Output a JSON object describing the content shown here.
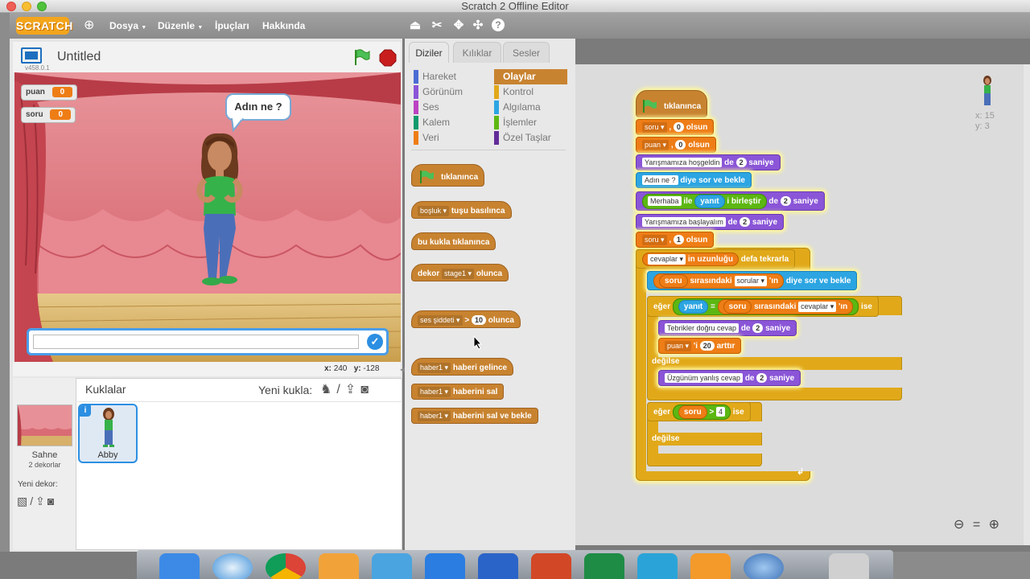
{
  "window": {
    "title": "Scratch 2 Offline Editor"
  },
  "menubar": {
    "logo": "SCRATCH",
    "items": [
      {
        "label": "Dosya",
        "has_arrow": true
      },
      {
        "label": "Düzenle",
        "has_arrow": true
      },
      {
        "label": "İpuçları",
        "has_arrow": false
      },
      {
        "label": "Hakkında",
        "has_arrow": false
      }
    ],
    "tools": [
      "duplicate-icon",
      "cut-icon",
      "grow-icon",
      "shrink-icon",
      "help-icon"
    ]
  },
  "stage": {
    "project_title": "Untitled",
    "version": "v458.0.1",
    "monitors": [
      {
        "name": "puan",
        "value": "0"
      },
      {
        "name": "soru",
        "value": "0"
      }
    ],
    "speech_bubble": "Adın ne ?",
    "answer_value": "",
    "coords": {
      "x_label": "x:",
      "x_value": "240",
      "y_label": "y:",
      "y_value": "-128"
    }
  },
  "sprites": {
    "heading": "Kuklalar",
    "new_sprite_label": "Yeni kukla:",
    "stage_label": "Sahne",
    "stage_backdrops": "2 dekorlar",
    "new_backdrop_label": "Yeni dekor:",
    "items": [
      {
        "name": "Abby",
        "selected": true
      }
    ]
  },
  "tabs": [
    {
      "label": "Diziler",
      "active": true
    },
    {
      "label": "Kılıklar",
      "active": false
    },
    {
      "label": "Sesler",
      "active": false
    }
  ],
  "categories": {
    "left": [
      {
        "label": "Hareket",
        "color": "#4a6cd4"
      },
      {
        "label": "Görünüm",
        "color": "#8a55d7"
      },
      {
        "label": "Ses",
        "color": "#bb42c3"
      },
      {
        "label": "Kalem",
        "color": "#0e9a6c"
      },
      {
        "label": "Veri",
        "color": "#ee7d16"
      }
    ],
    "right": [
      {
        "label": "Olaylar",
        "color": "#c88330",
        "active": true
      },
      {
        "label": "Kontrol",
        "color": "#e1a91a",
        "active": false
      },
      {
        "label": "Algılama",
        "color": "#2ca5e2",
        "active": false
      },
      {
        "label": "İşlemler",
        "color": "#5cb712",
        "active": false
      },
      {
        "label": "Özel Taşlar",
        "color": "#632d99",
        "active": false
      }
    ]
  },
  "palette": {
    "flag_clicked": "tıklanınca",
    "key_pressed": {
      "key": "boşluk",
      "text": "tuşu basılınca"
    },
    "sprite_clicked": "bu kukla tıklanınca",
    "backdrop_switch": {
      "prefix": "dekor",
      "value": "stage1",
      "suffix": "olunca"
    },
    "sensor": {
      "value": "ses şiddeti",
      "op": ">",
      "num": "10",
      "suffix": "olunca"
    },
    "receive": {
      "msg": "haber1",
      "text": "haberi gelince"
    },
    "broadcast": {
      "msg": "haber1",
      "text": "haberini sal"
    },
    "broadcast_wait": {
      "msg": "haber1",
      "text": "haberini sal ve bekle"
    }
  },
  "script": {
    "hat": "tıklanınca",
    "set1": {
      "var": "soru",
      "comma": ",",
      "value": "0",
      "suffix": "olsun"
    },
    "set2": {
      "var": "puan",
      "comma": ",",
      "value": "0",
      "suffix": "olsun"
    },
    "say1": {
      "text": "Yarışmamıza hoşgeldin",
      "de": "de",
      "secs": "2",
      "unit": "saniye"
    },
    "ask": {
      "text": "Adın ne ?",
      "suffix": "diye sor ve bekle"
    },
    "say2": {
      "text": "Merhaba",
      "join": "ile",
      "answer": "yanıt",
      "join2": "i birleştir",
      "de": "de",
      "secs": "2",
      "unit": "saniye"
    },
    "say3": {
      "text": "Yarışmamıza başlayalım",
      "de": "de",
      "secs": "2",
      "unit": "saniye"
    },
    "set3": {
      "var": "soru",
      "comma": ",",
      "value": "1",
      "suffix": "olsun"
    },
    "repeat": {
      "list": "cevaplar",
      "len": "in uzunluğu",
      "suffix": "defa tekrarla"
    },
    "ask2": {
      "var": "soru",
      "mid": "sırasındaki",
      "list": "sorular",
      "lin": "'ın",
      "suffix": "diye sor ve bekle"
    },
    "if1": {
      "if": "eğer",
      "answer": "yanıt",
      "eq": "=",
      "var": "soru",
      "mid": "sırasındaki",
      "list": "cevaplar",
      "lin": "'ın",
      "ise": "ise"
    },
    "say4": {
      "text": "Tebrikler doğru cevap",
      "de": "de",
      "secs": "2",
      "unit": "saniye"
    },
    "change": {
      "var": "puan",
      "suffix": "'i",
      "value": "20",
      "arttir": "arttır"
    },
    "else1": "değilse",
    "say5": {
      "text": "Üzgünüm yanlış cevap",
      "de": "de",
      "secs": "2",
      "unit": "saniye"
    },
    "if2": {
      "if": "eğer",
      "var": "soru",
      "gt": ">",
      "num": "4",
      "ise": "ise"
    },
    "else2": "değilse"
  },
  "sprite_info": {
    "x": "x: 15",
    "y": "y: 3"
  },
  "colors": {
    "events": "#c88330",
    "looks": "#8a55d7",
    "sensing": "#2ca5e2",
    "operators": "#5cb712",
    "data": "#ee7d16",
    "control": "#e1a91a"
  }
}
